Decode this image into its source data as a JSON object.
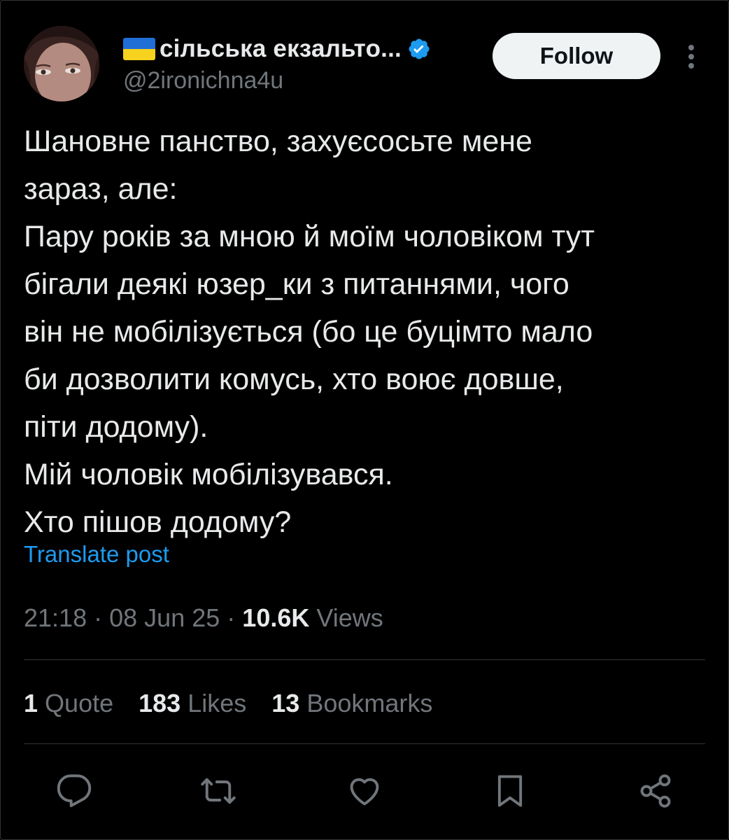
{
  "author": {
    "flag_icon": "ukraine-flag-icon",
    "display_name": "сільська екзальто...",
    "verified_icon": "verified-badge-icon",
    "handle": "@2ironichna4u"
  },
  "follow_label": "Follow",
  "tweet": {
    "lines": [
      "Шановне панство, захуєсосьте мене",
      "зараз, але:",
      "Пару років за мною й моїм чоловіком тут",
      "бігали деякі юзер_ки з питаннями, чого",
      "він не мобілізується (бо це буцімто мало",
      "би дозволити комусь, хто воює довше,",
      "піти додому).",
      "Мій чоловік мобілізувався.",
      "Хто пішов додому?"
    ],
    "translate_label": "Translate post"
  },
  "meta": {
    "time": "21:18",
    "sep1": "·",
    "date": "08 Jun 25",
    "sep2": "·",
    "views_count": "10.6K",
    "views_label": "Views"
  },
  "stats": {
    "quotes_count": "1",
    "quotes_label": "Quote",
    "likes_count": "183",
    "likes_label": "Likes",
    "bookmarks_count": "13",
    "bookmarks_label": "Bookmarks"
  },
  "colors": {
    "background": "#000000",
    "text": "#e7e9ea",
    "secondary": "#71767b",
    "accent": "#1d9bf0",
    "divider": "#2f3336"
  },
  "action_icons": [
    "reply-icon",
    "retweet-icon",
    "like-icon",
    "bookmark-icon",
    "share-icon"
  ]
}
